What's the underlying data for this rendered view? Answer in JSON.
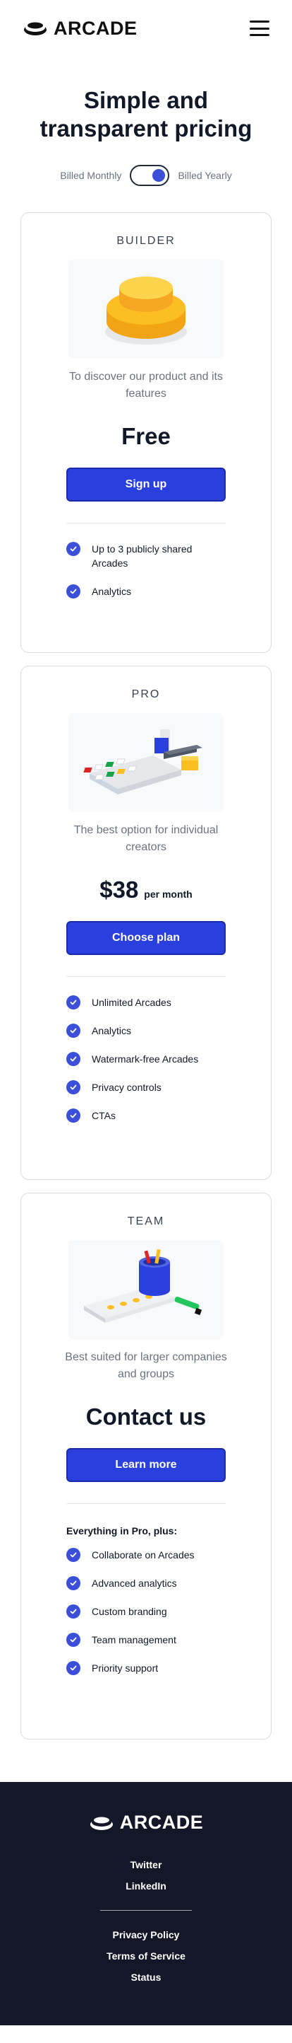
{
  "header": {
    "logo_text": "ARCADE",
    "menu_icon": "hamburger-menu-icon"
  },
  "hero": {
    "title": "Simple and transparent pricing"
  },
  "billing": {
    "monthly_label": "Billed Monthly",
    "yearly_label": "Billed Yearly",
    "selected": "yearly"
  },
  "plans": [
    {
      "name": "BUILDER",
      "illustration": "yellow-button-illustration",
      "description": "To discover our product and its features",
      "price": "Free",
      "price_unit": "",
      "cta": "Sign up",
      "features_heading": "",
      "features": [
        "Up to 3 publicly shared Arcades",
        "Analytics"
      ]
    },
    {
      "name": "PRO",
      "illustration": "keyboard-blocks-illustration",
      "description": "The best option for individual creators",
      "price": "$38",
      "price_unit": "per month",
      "cta": "Choose plan",
      "features_heading": "",
      "features": [
        "Unlimited Arcades",
        "Analytics",
        "Watermark-free Arcades",
        "Privacy controls",
        "CTAs"
      ]
    },
    {
      "name": "TEAM",
      "illustration": "pencil-cup-illustration",
      "description": "Best suited for larger companies and groups",
      "price": "Contact us",
      "price_unit": "",
      "cta": "Learn more",
      "features_heading": "Everything in Pro, plus:",
      "features": [
        "Collaborate on Arcades",
        "Advanced analytics",
        "Custom branding",
        "Team management",
        "Priority support"
      ]
    }
  ],
  "footer": {
    "logo_text": "ARCADE",
    "social_links": [
      "Twitter",
      "LinkedIn"
    ],
    "legal_links": [
      "Privacy Policy",
      "Terms of Service",
      "Status"
    ]
  },
  "colors": {
    "accent": "#2a40de",
    "check": "#3b4fd8",
    "footer_bg": "#141728",
    "text": "#111827",
    "muted": "#6b7280"
  }
}
